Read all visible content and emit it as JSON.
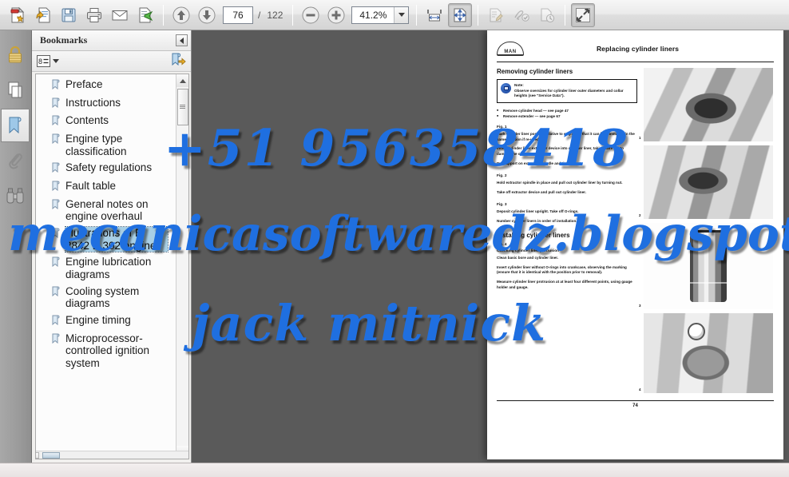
{
  "toolbar": {
    "buttons": [
      {
        "name": "create-pdf-button",
        "icon": "new-document-icon",
        "label": "Create PDF"
      },
      {
        "name": "export-pdf-button",
        "icon": "export-document-icon",
        "label": "Export PDF"
      },
      {
        "name": "save-button",
        "icon": "floppy-disk-icon",
        "label": "Save"
      },
      {
        "name": "print-button",
        "icon": "printer-icon",
        "label": "Print"
      },
      {
        "name": "email-button",
        "icon": "envelope-icon",
        "label": "Email"
      },
      {
        "name": "send-file-button",
        "icon": "send-document-icon",
        "label": "Send File"
      }
    ],
    "nav": {
      "previous_page_label": "Previous Page",
      "next_page_label": "Next Page",
      "current_page": "76",
      "page_separator": "/",
      "total_pages": "122"
    },
    "zoom": {
      "zoom_out_label": "Zoom Out",
      "zoom_in_label": "Zoom In",
      "value": "41.2%",
      "dropdown_label": "Zoom Level Options"
    },
    "view_buttons": [
      {
        "name": "fit-width-button",
        "icon": "fit-width-icon",
        "label": "Fit Width",
        "state": "normal"
      },
      {
        "name": "fit-page-button",
        "icon": "fit-page-icon",
        "label": "Fit Page",
        "state": "pressed"
      }
    ],
    "tool_buttons": [
      {
        "name": "comment-button",
        "icon": "comment-edit-icon",
        "label": "Comment",
        "state": "disabled"
      },
      {
        "name": "sign-button",
        "icon": "sign-document-icon",
        "label": "Sign",
        "state": "disabled"
      },
      {
        "name": "history-button",
        "icon": "document-history-icon",
        "label": "History",
        "state": "disabled"
      }
    ],
    "fullscreen": {
      "name": "fullscreen-button",
      "icon": "expand-arrows-icon",
      "label": "Full Screen"
    }
  },
  "rail": {
    "items": [
      {
        "name": "sidebar-item-signatures",
        "icon": "lock-icon",
        "label": "Signatures",
        "active": false
      },
      {
        "name": "sidebar-item-pages",
        "icon": "pages-icon",
        "label": "Page Thumbnails",
        "active": false
      },
      {
        "name": "sidebar-item-bookmarks",
        "icon": "bookmark-icon",
        "label": "Bookmarks",
        "active": true
      },
      {
        "name": "sidebar-item-attachments",
        "icon": "paperclip-icon",
        "label": "Attachments",
        "active": false
      },
      {
        "name": "sidebar-item-search",
        "icon": "binoculars-icon",
        "label": "Search",
        "active": false
      }
    ]
  },
  "bookmarks_panel": {
    "title": "Bookmarks",
    "collapse_label": "Collapse Panel",
    "options_label": "Bookmark Options",
    "expand_current_label": "Expand Current Bookmark",
    "items": [
      {
        "label": "Preface",
        "selected": false
      },
      {
        "label": "Instructions",
        "selected": false
      },
      {
        "label": "Contents",
        "selected": false
      },
      {
        "label": "Engine type classification",
        "selected": false
      },
      {
        "label": "Safety regulations",
        "selected": false
      },
      {
        "label": "Fault table",
        "selected": false
      },
      {
        "label": "General notes on engine overhaul",
        "selected": false
      },
      {
        "label": "Illustrations of E 2842 E 302 engine",
        "selected": true
      },
      {
        "label": "Engine lubrication diagrams",
        "selected": false
      },
      {
        "label": "Cooling system diagrams",
        "selected": false
      },
      {
        "label": "Engine timing",
        "selected": false
      },
      {
        "label": "Microprocessor-controlled ignition system",
        "selected": false
      }
    ]
  },
  "document": {
    "logo_text": "MAN",
    "header_title": "Replacing cylinder liners",
    "page_number": "74",
    "sections": {
      "removing_heading": "Removing cylinder liners",
      "note_label": "Note:",
      "note_text": "Observe oversizes for cylinder liner outer diameters and collar heights (see \"Service Data\").",
      "bullets": [
        "Remove cylinder head — see page 47",
        "Remove extender — see page 67"
      ],
      "fig1_label": "Fig. 1",
      "fig1_paras": [
        "Mark cylinder liner position relative to engine so that it can be reinstalled in the same position if re-used.",
        "Insert cylinder liner extractor device into cylinder liner, taking care not to damage the oil spray nozzle.",
        "Put support on extractor spindle and tighten nut."
      ],
      "fig2_label": "Fig. 2",
      "fig2_paras": [
        "Hold extractor spindle in place and pull out cylinder liner by turning nut.",
        "Take off extractor device and pull out cylinder liner."
      ],
      "fig3_label": "Fig. 3",
      "fig3_paras": [
        "Deposit cylinder liner upright. Take off O-rings.",
        "Number cylinder liners in order of installation."
      ],
      "installing_heading": "Installing cylinder liners",
      "fig4_label": "Fig. 4",
      "fig4_subheading": "Checking cylinder liner protrusion",
      "fig4_paras": [
        "Clean basic bore and cylinder liner.",
        "Insert cylinder liner without O-rings into crankcase, observing the marking (ensure that it is identical with the position prior to removal).",
        "Measure cylinder liner protrusion at at least four different points, using gauge holder and gauge."
      ]
    },
    "figures": [
      {
        "name": "figure-1-photo",
        "caption": "1"
      },
      {
        "name": "figure-2-photo",
        "caption": "2"
      },
      {
        "name": "figure-3-photo",
        "caption": "3"
      },
      {
        "name": "figure-4-photo",
        "caption": "4"
      }
    ]
  },
  "watermark": {
    "phone": "+51 956358418",
    "site": "mecanicasoftwaredz.blogspot.pe",
    "name": "jack mitnick",
    "color": "#1f6fe0"
  }
}
